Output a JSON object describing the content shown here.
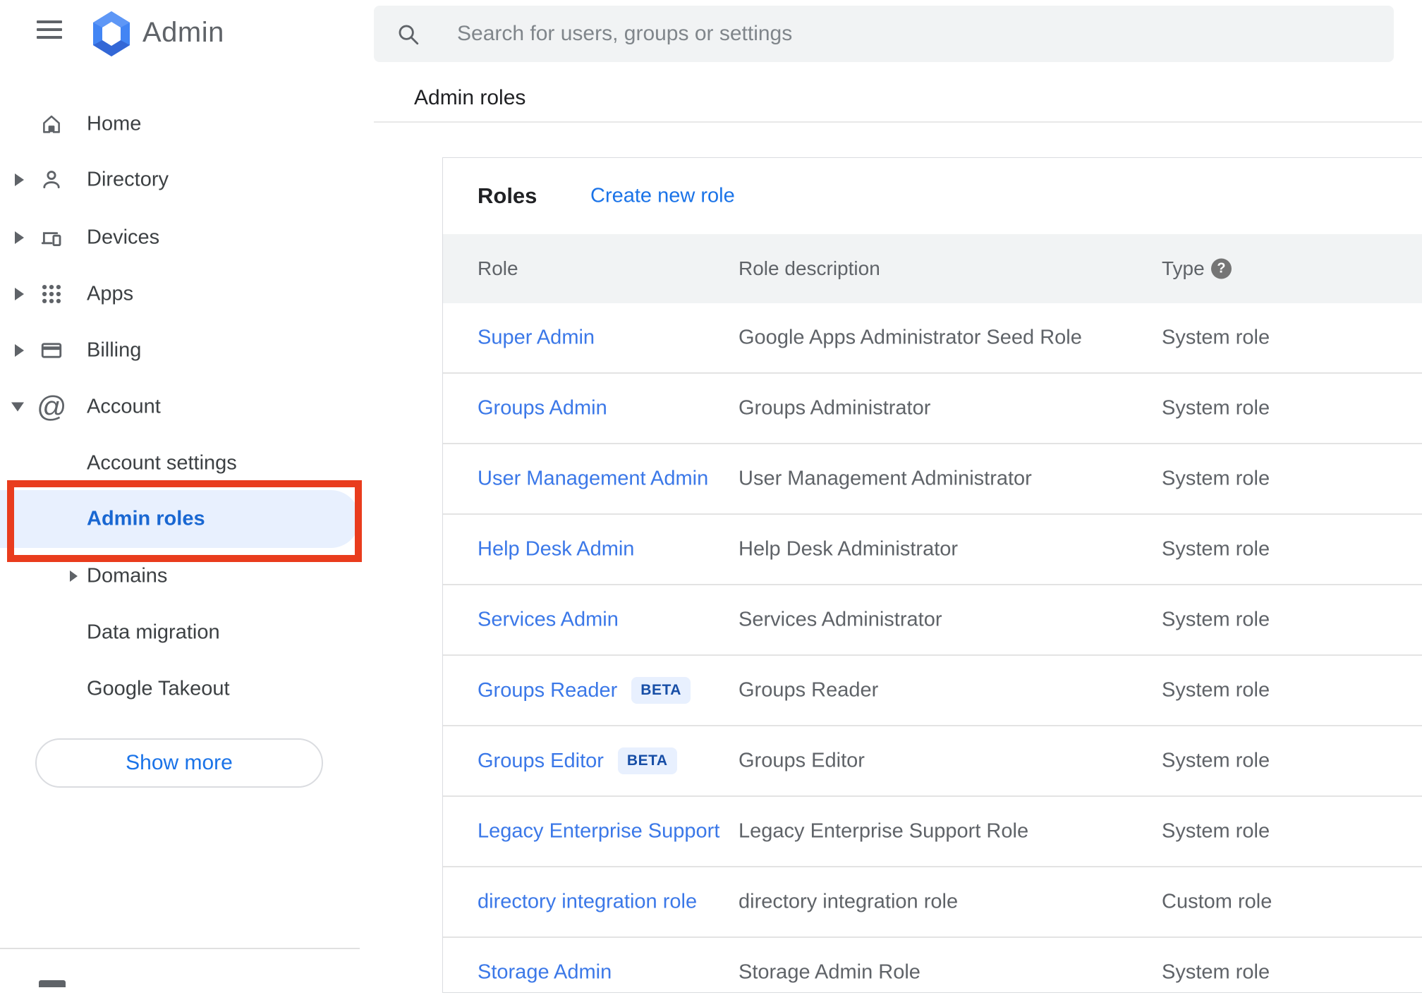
{
  "app": {
    "name": "Admin"
  },
  "topbar": {
    "search_placeholder": "Search for users, groups or settings"
  },
  "breadcrumb": "Admin roles",
  "sidebar": {
    "items": [
      {
        "label": "Home"
      },
      {
        "label": "Directory"
      },
      {
        "label": "Devices"
      },
      {
        "label": "Apps"
      },
      {
        "label": "Billing"
      },
      {
        "label": "Account"
      },
      {
        "label": "Account settings"
      },
      {
        "label": "Admin roles"
      },
      {
        "label": "Domains"
      },
      {
        "label": "Data migration"
      },
      {
        "label": "Google Takeout"
      }
    ],
    "selected_item": "Admin roles",
    "show_more_label": "Show more"
  },
  "main": {
    "card_title": "Roles",
    "create_link": "Create new role",
    "columns": {
      "role": "Role",
      "description": "Role description",
      "type": "Type"
    },
    "help_icon_glyph": "?",
    "rows": [
      {
        "role": "Super Admin",
        "description": "Google Apps Administrator Seed Role",
        "type": "System role"
      },
      {
        "role": "Groups Admin",
        "description": "Groups Administrator",
        "type": "System role"
      },
      {
        "role": "User Management Admin",
        "description": "User Management Administrator",
        "type": "System role"
      },
      {
        "role": "Help Desk Admin",
        "description": "Help Desk Administrator",
        "type": "System role"
      },
      {
        "role": "Services Admin",
        "description": "Services Administrator",
        "type": "System role"
      },
      {
        "role": "Groups Reader",
        "badge": "BETA",
        "description": "Groups Reader",
        "type": "System role"
      },
      {
        "role": "Groups Editor",
        "badge": "BETA",
        "description": "Groups Editor",
        "type": "System role"
      },
      {
        "role": "Legacy Enterprise Support",
        "description": "Legacy Enterprise Support Role",
        "type": "System role"
      },
      {
        "role": "directory integration role",
        "description": "directory integration role",
        "type": "Custom role"
      },
      {
        "role": "Storage Admin",
        "description": "Storage Admin Role",
        "type": "System role"
      }
    ]
  },
  "colors": {
    "link_blue": "#3b78e8",
    "accent_blue": "#1a73e8",
    "selected_blue": "#1967d2",
    "selected_pill_bg": "#e8f0fe",
    "annotation_red": "#e93c1d",
    "table_header_bg": "#f1f3f4",
    "muted_text": "#5f6368",
    "beta_badge_bg": "#e8f0fe",
    "beta_badge_text": "#174ea6"
  }
}
